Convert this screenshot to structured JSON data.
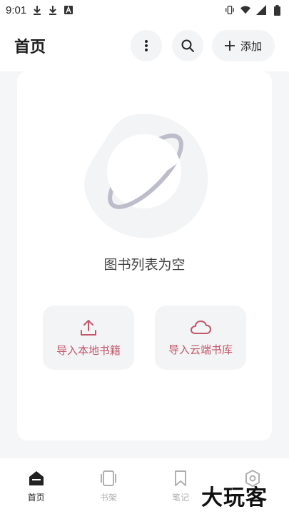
{
  "status_bar": {
    "time": "9:01",
    "left_icons": [
      "download-icon",
      "download-icon",
      "font-icon"
    ],
    "right_icons": [
      "vibrate-icon",
      "wifi-icon",
      "signal-icon",
      "battery-icon"
    ]
  },
  "header": {
    "title": "首页",
    "more_icon": "more-vertical-icon",
    "search_icon": "search-icon",
    "add_label": "添加"
  },
  "main": {
    "empty_text": "图书列表为空",
    "import_local_label": "导入本地书籍",
    "import_cloud_label": "导入云端书库"
  },
  "bottom_nav": {
    "items": [
      {
        "label": "首页",
        "icon": "home-icon",
        "active": true
      },
      {
        "label": "书架",
        "icon": "bookshelf-icon",
        "active": false
      },
      {
        "label": "笔记",
        "icon": "bookmark-icon",
        "active": false
      },
      {
        "label": "",
        "icon": "settings-icon",
        "active": false
      }
    ]
  },
  "watermark": "大玩客",
  "colors": {
    "accent": "#c2566a",
    "background": "#f5f6f8",
    "button_bg": "#f3f4f6"
  }
}
